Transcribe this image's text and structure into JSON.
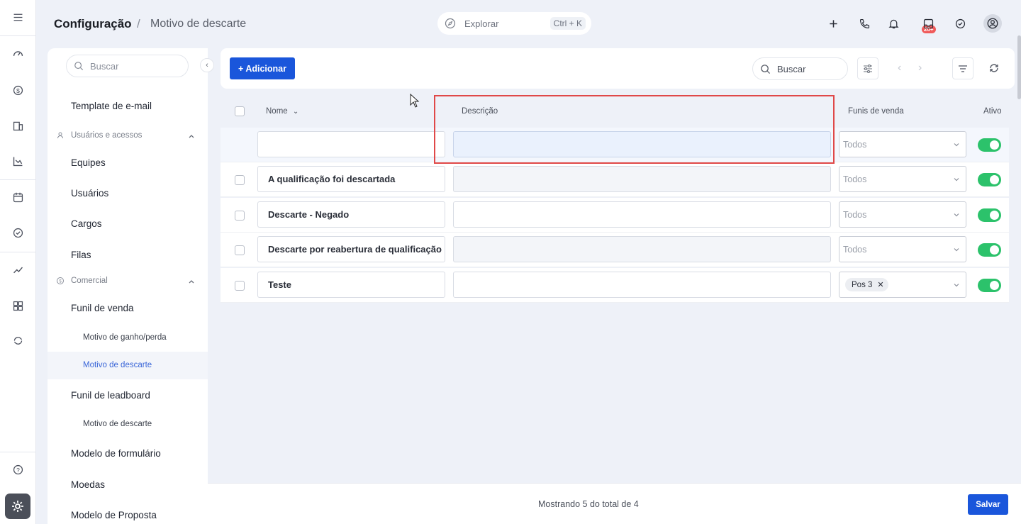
{
  "header": {
    "breadcrumb_main": "Configuração",
    "breadcrumb_sep": "/",
    "breadcrumb_sub": "Motivo de descarte",
    "explore_label": "Explorar",
    "explore_shortcut": "Ctrl + K",
    "notification_badge": "20+"
  },
  "sidebar": {
    "search_placeholder": "Buscar",
    "items": {
      "template_email": "Template de e-mail",
      "group_users": "Usuários e acessos",
      "equipes": "Equipes",
      "usuarios": "Usuários",
      "cargos": "Cargos",
      "filas": "Filas",
      "group_comercial": "Comercial",
      "funil_venda": "Funil de venda",
      "motivo_ganho": "Motivo de ganho/perda",
      "motivo_descarte": "Motivo de descarte",
      "funil_leadboard": "Funil de leadboard",
      "motivo_descarte_2": "Motivo de descarte",
      "modelo_formulario": "Modelo de formulário",
      "moedas": "Moedas",
      "modelo_proposta": "Modelo de Proposta"
    }
  },
  "toolbar": {
    "add_label": "+ Adicionar",
    "search_placeholder": "Buscar"
  },
  "table": {
    "headers": {
      "name": "Nome",
      "description": "Descrição",
      "funnels": "Funis de venda",
      "active": "Ativo"
    },
    "new_row": {
      "name": "",
      "description": "",
      "funnel": "Todos"
    },
    "rows": [
      {
        "name": "A qualificação foi descartada",
        "description": "",
        "funnel": "Todos",
        "active": true
      },
      {
        "name": "Descarte - Negado",
        "description": "",
        "funnel": "Todos",
        "active": true
      },
      {
        "name": "Descarte por reabertura de qualificação",
        "description": "",
        "funnel": "Todos",
        "active": true
      },
      {
        "name": "Teste",
        "description": "",
        "funnel_chip": "Pos 3",
        "active": true
      }
    ]
  },
  "footer": {
    "info": "Mostrando 5 do total de 4",
    "save_label": "Salvar"
  },
  "colors": {
    "primary": "#1a56db",
    "toggle_on": "#2cc26b",
    "highlight": "#e04848",
    "active_link": "#3a66d8"
  }
}
